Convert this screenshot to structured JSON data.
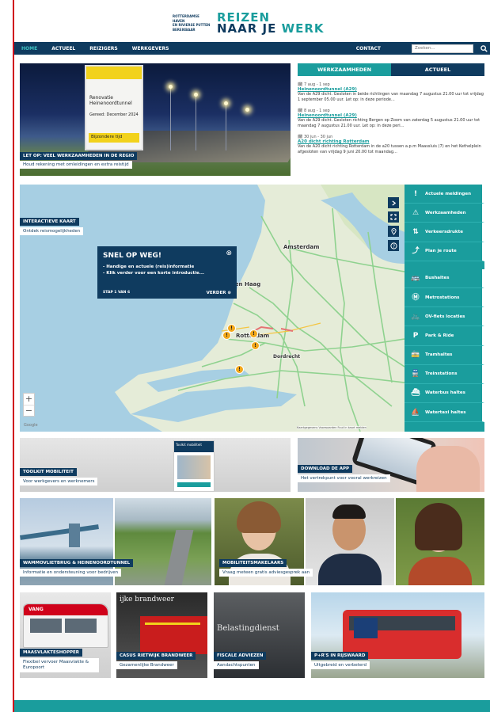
{
  "logo": {
    "small_lines": [
      "Rotterdamse Haven",
      "en Rivierse Putten",
      "Bereikbaar"
    ],
    "line1": "REIZEN",
    "line2a": "NAAR JE ",
    "line2b": "WERK"
  },
  "nav": {
    "items": [
      "HOME",
      "ACTUEEL",
      "REIZIGERS",
      "WERKGEVERS"
    ],
    "contact": "CONTACT",
    "search_placeholder": "Zoeken..."
  },
  "hero": {
    "title": "LET OP: VEEL WERKZAAMHEDEN IN DE REGIO",
    "subtitle": "Houd rekening met omleidingen en extra reistijd",
    "sign_text": [
      "Renovatie",
      "Heinenoordtunnel"
    ],
    "sign_date": "Gereed: December 2024",
    "sign_yellow": "Bijzondere tijd"
  },
  "news": {
    "tabs": [
      "WERKZAAMHEDEN",
      "ACTUEEL"
    ],
    "items": [
      {
        "date": "7 aug - 1 sep",
        "title": "Heinenoordtunnel (A29)",
        "body": "Van de A29 dicht. Gesloten in beide richtingen van maandag 7 augustus 21.00 uur tot vrijdag 1 september 05.00 uur. Let op: in deze periode..."
      },
      {
        "date": "8 aug - 1 sep",
        "title": "Heinenoordtunnel (A29)",
        "body": "Van de A29 dicht. Gesloten richting Bergen op Zoom van zaterdag 5 augustus 21.00 uur tot maandag 7 augustus 21.00 uur. Let op: in deze peri..."
      },
      {
        "date": "30 jun - 30 jun",
        "title": "A20 dicht richting Rotterdam",
        "body": "Van de A20 dicht richting Rotterdam in de a20 tussen a.p.m Maassluis (7) en het Kethelplein afgesloten van vrijdag 9 juni 20.00 tot maandag..."
      }
    ]
  },
  "map": {
    "label_title": "INTERACTIEVE KAART",
    "label_sub": "Ontdek reismogelijkheden",
    "cities": [
      "Amsterdam",
      "Den Haag",
      "Rotterdam",
      "Dordrecht"
    ],
    "popup": {
      "title": "SNEL OP WEG!",
      "lines": [
        "- Handige en actuele (reis)informatie",
        "- Klik verder voor een korte introductie..."
      ],
      "step": "STAP 1 VAN 6",
      "more": "VERDER"
    },
    "google": "Google",
    "attribution": "Kaartgegevens  Voorwaarden  Fout in kaart melden",
    "menu_top": [
      {
        "icon": "alert-icon",
        "glyph": "!",
        "label": "Actuele meldingen"
      },
      {
        "icon": "roadwork-icon",
        "glyph": "⚠",
        "label": "Werkzaamheden"
      },
      {
        "icon": "traffic-icon",
        "glyph": "⇅",
        "label": "Verkeersdrukte"
      },
      {
        "icon": "route-icon",
        "glyph": "⤴",
        "label": "Plan je route"
      }
    ],
    "menu_bottom": [
      {
        "icon": "bus-icon",
        "glyph": "🚌",
        "label": "Bushaltes"
      },
      {
        "icon": "metro-icon",
        "glyph": "Ⓜ",
        "label": "Metrostations"
      },
      {
        "icon": "bike-icon",
        "glyph": "🚲",
        "label": "OV-fiets locaties"
      },
      {
        "icon": "parkride-icon",
        "glyph": "P",
        "label": "Park & Ride"
      },
      {
        "icon": "tram-icon",
        "glyph": "🚋",
        "label": "Tramhaltes"
      },
      {
        "icon": "train-icon",
        "glyph": "🚆",
        "label": "Treinstations"
      },
      {
        "icon": "waterbus-icon",
        "glyph": "⛴",
        "label": "Waterbus haltes"
      },
      {
        "icon": "watertaxi-icon",
        "glyph": "⛵",
        "label": "Watertaxi haltes"
      }
    ]
  },
  "banners": [
    {
      "title": "TOOLKIT MOBILITEIT",
      "subtitle": "Voor werkgevers en werknemers",
      "booklet": "Toolkit mobiliteit"
    },
    {
      "title": "DOWNLOAD DE APP",
      "subtitle": "Het vertrekpunt voor vooral werkreizen"
    }
  ],
  "tiles_row1": [
    {
      "title": "WAMMOVLIETBRUG & HEINENOORDTUNNEL",
      "subtitle": "Informatie en ondersteuning voor bedrijven"
    },
    {
      "title": "MOBILITEITSMAKELAARS",
      "subtitle": "Vraag meteen gratis adviesgesprek aan"
    }
  ],
  "tiles_row2": [
    {
      "title": "MAASVLAKTESHOPPER",
      "subtitle": "Flexibel vervoer Maasvlakte & Europoort",
      "tag": "VANG"
    },
    {
      "title": "CASUS RIETWIJK BRANDWEER",
      "subtitle": "Gezamenlijke Brandweer",
      "sign": "ijke brandweer"
    },
    {
      "title": "FISCALE ADVIEZEN",
      "subtitle": "Aandachtspunten",
      "sign": "Belastingdienst"
    },
    {
      "title": "P+R'S IN RIJSWAARD",
      "subtitle": "Uitgebreid en verbeterd"
    }
  ]
}
